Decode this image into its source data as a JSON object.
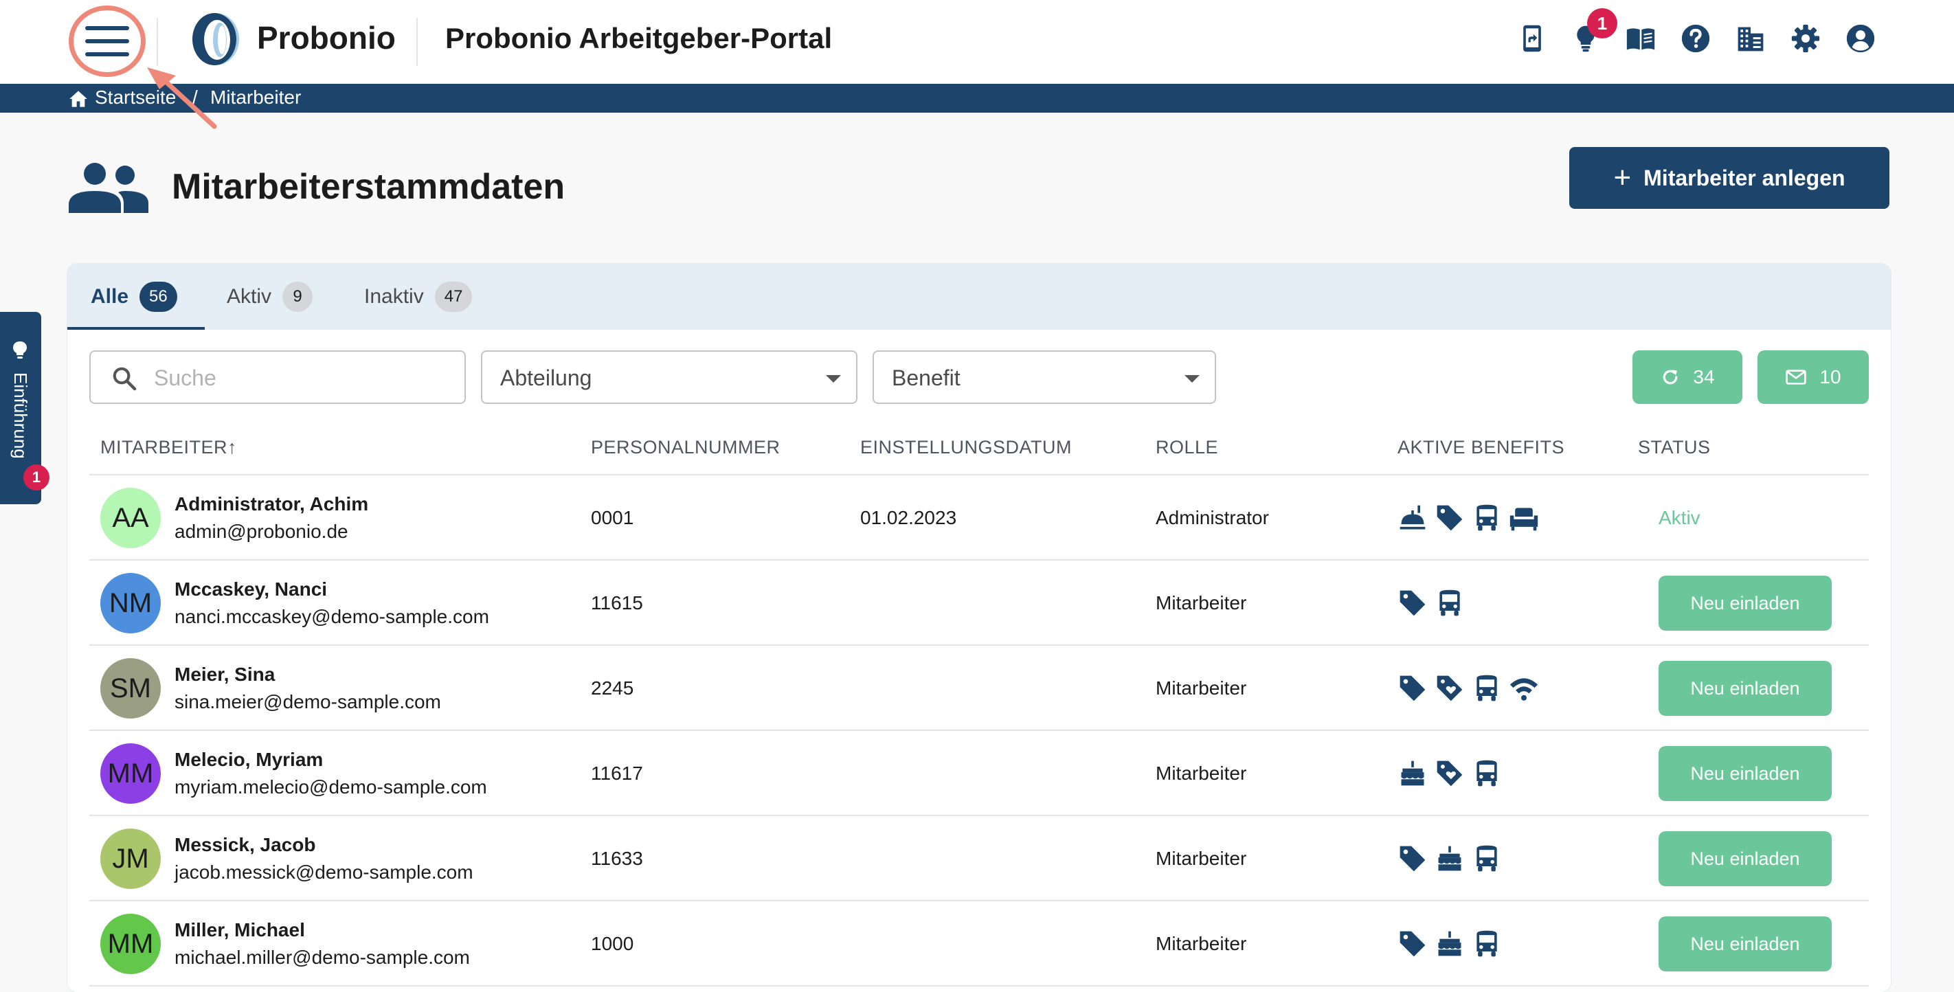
{
  "header": {
    "brand": "Probonio",
    "portal_title": "Probonio Arbeitgeber-Portal",
    "notification_count": "1",
    "icons": [
      "phone-share-icon",
      "lightbulb-icon",
      "book-icon",
      "help-icon",
      "building-icon",
      "gear-icon",
      "account-icon"
    ]
  },
  "breadcrumb": {
    "home": "Startseite",
    "separator": "/",
    "current": "Mitarbeiter"
  },
  "page": {
    "title": "Mitarbeiterstammdaten",
    "add_button": "Mitarbeiter anlegen"
  },
  "side_tab": {
    "label": "Einführung",
    "badge": "1"
  },
  "tabs": [
    {
      "label": "Alle",
      "count": "56"
    },
    {
      "label": "Aktiv",
      "count": "9"
    },
    {
      "label": "Inaktiv",
      "count": "47"
    }
  ],
  "filters": {
    "search_placeholder": "Suche",
    "department": "Abteilung",
    "benefit": "Benefit",
    "refresh_count": "34",
    "mail_count": "10"
  },
  "table": {
    "columns": [
      "MITARBEITER",
      "PERSONALNUMMER",
      "EINSTELLUNGSDATUM",
      "ROLLE",
      "AKTIVE BENEFITS",
      "STATUS"
    ],
    "sort_indicator": "↑",
    "rows": [
      {
        "initials": "AA",
        "avatar_color": "#b3f7b3",
        "name": "Administrator, Achim",
        "email": "admin@probonio.de",
        "personal_number": "0001",
        "hire_date": "01.02.2023",
        "role": "Administrator",
        "benefits": [
          "lunch-icon",
          "tag-icon",
          "bus-icon",
          "sofa-icon"
        ],
        "status": "Aktiv",
        "action": ""
      },
      {
        "initials": "NM",
        "avatar_color": "#4d8fdc",
        "name": "Mccaskey, Nanci",
        "email": "nanci.mccaskey@demo-sample.com",
        "personal_number": "11615",
        "hire_date": "",
        "role": "Mitarbeiter",
        "benefits": [
          "tag-icon",
          "bus-icon"
        ],
        "status": "",
        "action": "Neu einladen"
      },
      {
        "initials": "SM",
        "avatar_color": "#9a9f84",
        "name": "Meier, Sina",
        "email": "sina.meier@demo-sample.com",
        "personal_number": "2245",
        "hire_date": "",
        "role": "Mitarbeiter",
        "benefits": [
          "tag-icon",
          "tag-heart-icon",
          "bus-icon",
          "wifi-icon"
        ],
        "status": "",
        "action": "Neu einladen"
      },
      {
        "initials": "MM",
        "avatar_color": "#8c3fe4",
        "name": "Melecio, Myriam",
        "email": "myriam.melecio@demo-sample.com",
        "personal_number": "11617",
        "hire_date": "",
        "role": "Mitarbeiter",
        "benefits": [
          "cake-icon",
          "tag-heart-icon",
          "bus-icon"
        ],
        "status": "",
        "action": "Neu einladen"
      },
      {
        "initials": "JM",
        "avatar_color": "#a9c66a",
        "name": "Messick, Jacob",
        "email": "jacob.messick@demo-sample.com",
        "personal_number": "11633",
        "hire_date": "",
        "role": "Mitarbeiter",
        "benefits": [
          "tag-icon",
          "cake-icon",
          "bus-icon"
        ],
        "status": "",
        "action": "Neu einladen"
      },
      {
        "initials": "MM",
        "avatar_color": "#62c74a",
        "name": "Miller, Michael",
        "email": "michael.miller@demo-sample.com",
        "personal_number": "1000",
        "hire_date": "",
        "role": "Mitarbeiter",
        "benefits": [
          "tag-icon",
          "cake-icon",
          "bus-icon"
        ],
        "status": "",
        "action": "Neu einladen"
      }
    ]
  },
  "colors": {
    "primary": "#1d456c",
    "success": "#6bc69a",
    "badge": "#d7204f",
    "highlight": "#ee8878"
  }
}
